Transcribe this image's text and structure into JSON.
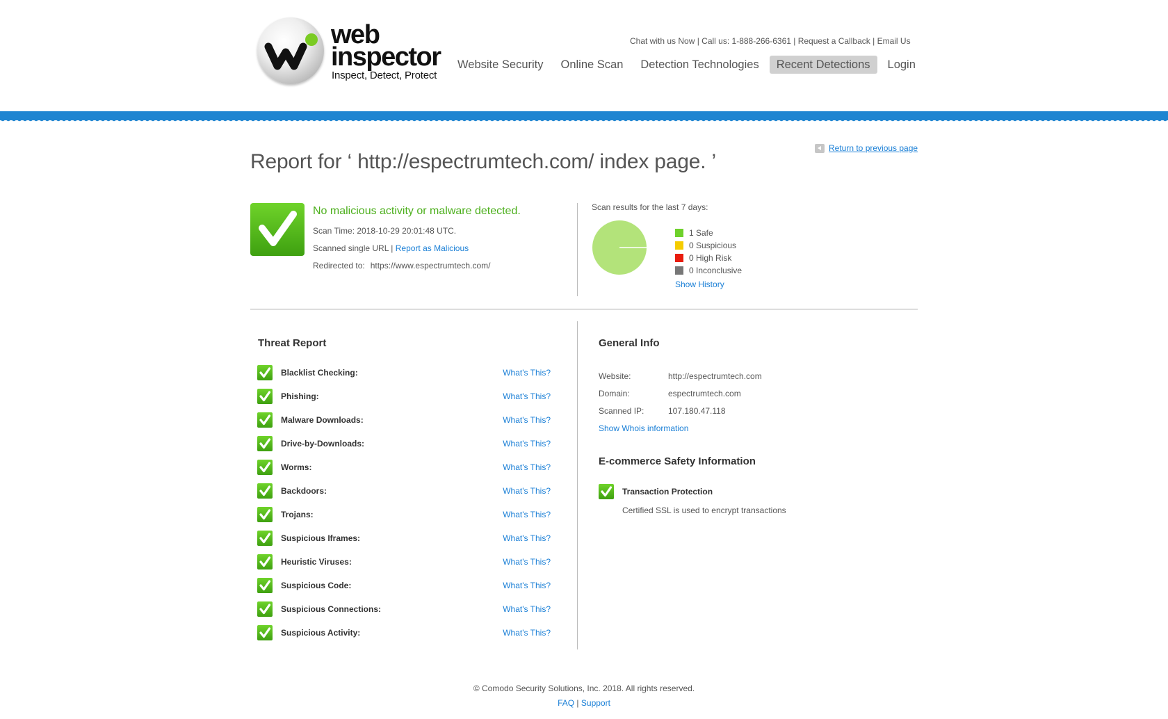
{
  "brand": {
    "name_line1": "web",
    "name_line2": "inspector",
    "tagline": "Inspect, Detect, Protect",
    "colors": {
      "green": "#4caf1c",
      "blue_bar": "#1f85d1",
      "link": "#1a7fd6"
    }
  },
  "contact_bar": {
    "chat": "Chat with us Now",
    "call": "Call us: 1-888-266-6361",
    "callback": "Request a Callback",
    "email": "Email Us",
    "separator": " | "
  },
  "nav": [
    {
      "label": "Website Security",
      "active": false
    },
    {
      "label": "Online Scan",
      "active": false
    },
    {
      "label": "Detection Technologies",
      "active": false
    },
    {
      "label": "Recent Detections",
      "active": true
    },
    {
      "label": "Login",
      "active": false
    }
  ],
  "return_link": "Return to previous page",
  "report_title": "Report for ‘ http://espectrumtech.com/ index page. ’",
  "status": {
    "headline": "No malicious activity or malware detected.",
    "scan_time": "Scan Time: 2018-10-29 20:01:48 UTC.",
    "scanned": "Scanned single URL |",
    "report_malicious": "Report as Malicious",
    "redirected_label": "Redirected to:",
    "redirected_value": "https://www.espectrumtech.com/"
  },
  "scan_summary": {
    "label": "Scan results for the last 7 days:",
    "legend": [
      {
        "label": "1 Safe",
        "color": "#6ed12b",
        "count": 1
      },
      {
        "label": "0 Suspicious",
        "color": "#f5cc00",
        "count": 0
      },
      {
        "label": "0 High Risk",
        "color": "#e81c0e",
        "count": 0
      },
      {
        "label": "0 Inconclusive",
        "color": "#777777",
        "count": 0
      }
    ],
    "pie_color": "#b3e37a",
    "show_history": "Show History"
  },
  "threat_report": {
    "title": "Threat Report",
    "whats_this": "What's This?",
    "items": [
      {
        "label": "Blacklist Checking:"
      },
      {
        "label": "Phishing:"
      },
      {
        "label": "Malware Downloads:"
      },
      {
        "label": "Drive-by-Downloads:"
      },
      {
        "label": "Worms:"
      },
      {
        "label": "Backdoors:"
      },
      {
        "label": "Trojans:"
      },
      {
        "label": "Suspicious Iframes:"
      },
      {
        "label": "Heuristic Viruses:"
      },
      {
        "label": "Suspicious Code:"
      },
      {
        "label": "Suspicious Connections:"
      },
      {
        "label": "Suspicious Activity:"
      }
    ]
  },
  "general_info": {
    "title": "General Info",
    "website_label": "Website:",
    "website_value": "http://espectrumtech.com",
    "domain_label": "Domain:",
    "domain_value": "espectrumtech.com",
    "ip_label": "Scanned IP:",
    "ip_value": "107.180.47.118",
    "whois_link": "Show Whois information"
  },
  "ecommerce": {
    "title": "E-commerce Safety Information",
    "item_label": "Transaction Protection",
    "item_desc": "Certified SSL is used to encrypt transactions"
  },
  "footer": {
    "copyright": "© Comodo Security Solutions, Inc. 2018. All rights reserved.",
    "faq": "FAQ",
    "separator": " | ",
    "support": "Support"
  }
}
